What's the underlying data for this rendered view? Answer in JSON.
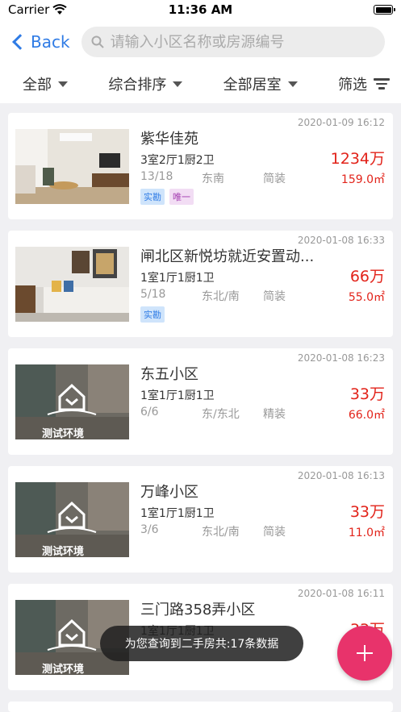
{
  "status_bar": {
    "carrier": "Carrier",
    "time": "11:36 AM"
  },
  "nav": {
    "back_label": "Back",
    "search_placeholder": "请输入小区名称或房源编号"
  },
  "filters": {
    "items": [
      {
        "label": "全部"
      },
      {
        "label": "综合排序"
      },
      {
        "label": "全部居室"
      }
    ],
    "filter_label": "筛选"
  },
  "listings": [
    {
      "title": "紫华佳苑",
      "layout": "3室2厅1厨2卫",
      "floor": "13/18",
      "direction": "东南",
      "decoration": "简装",
      "price": "1234万",
      "unit_price": "159.0㎡",
      "date": "2020-01-09 16:12",
      "tags": [
        "实勘",
        "唯一"
      ],
      "image": "photo-living-room"
    },
    {
      "title": "闸北区新悦坊就近安置动...",
      "layout": "1室1厅1厨1卫",
      "floor": "5/18",
      "direction": "东北/南",
      "decoration": "简装",
      "price": "66万",
      "unit_price": "55.0㎡",
      "date": "2020-01-08 16:33",
      "tags": [
        "实勘"
      ],
      "image": "photo-sofa"
    },
    {
      "title": "东五小区",
      "layout": "1室1厅1厨1卫",
      "floor": "6/6",
      "direction": "东/东北",
      "decoration": "精装",
      "price": "33万",
      "unit_price": "66.0㎡",
      "date": "2020-01-08 16:23",
      "tags": [],
      "image": "placeholder",
      "placeholder_text": "测试环境"
    },
    {
      "title": "万峰小区",
      "layout": "1室1厅1厨1卫",
      "floor": "3/6",
      "direction": "东北/南",
      "decoration": "简装",
      "price": "33万",
      "unit_price": "11.0㎡",
      "date": "2020-01-08 16:13",
      "tags": [],
      "image": "placeholder",
      "placeholder_text": "测试环境"
    },
    {
      "title": "三门路358弄小区",
      "layout": "1室1厅1厨1卫",
      "floor": "",
      "direction": "",
      "decoration": "",
      "price": "33万",
      "unit_price": "",
      "date": "2020-01-08 16:11",
      "tags": [],
      "image": "placeholder",
      "placeholder_text": "测试环境"
    }
  ],
  "toast": {
    "message": "为您查询到二手房共:17条数据"
  },
  "fab": {
    "icon": "plus-icon",
    "color": "#e8336b"
  },
  "colors": {
    "accent": "#2f7be5",
    "price": "#e2231a"
  }
}
